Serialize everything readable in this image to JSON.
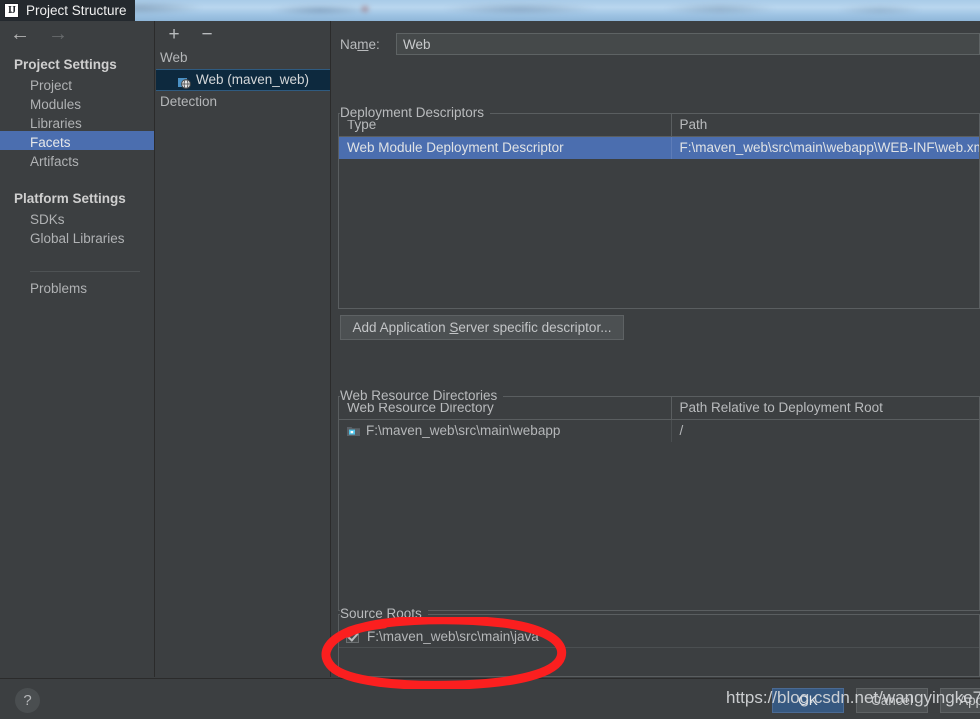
{
  "window": {
    "title": "Project Structure",
    "app_icon": "intellij-idea-icon",
    "icon_text": "IJ"
  },
  "nav": {
    "back_icon": "arrow-left-icon",
    "forward_icon": "arrow-right-icon",
    "groups": [
      {
        "header": "Project Settings",
        "items": [
          {
            "label": "Project",
            "selected": false
          },
          {
            "label": "Modules",
            "selected": false
          },
          {
            "label": "Libraries",
            "selected": false
          },
          {
            "label": "Facets",
            "selected": true
          },
          {
            "label": "Artifacts",
            "selected": false
          }
        ]
      },
      {
        "header": "Platform Settings",
        "items": [
          {
            "label": "SDKs",
            "selected": false
          },
          {
            "label": "Global Libraries",
            "selected": false
          }
        ]
      }
    ],
    "problems": "Problems"
  },
  "facets": {
    "toolbar": {
      "add_label": "+",
      "remove_label": "−"
    },
    "tree": [
      {
        "label": "Web",
        "type": "group",
        "selected": false
      },
      {
        "label": "Web (maven_web)",
        "type": "facet",
        "selected": true
      },
      {
        "label": "Detection",
        "type": "group",
        "selected": false
      }
    ]
  },
  "detail": {
    "name_label_pre": "Na",
    "name_label_mnemonic": "m",
    "name_label_post": "e:",
    "name_value": "Web",
    "name_placeholder": "",
    "deployment_descriptors": {
      "title": "Deployment Descriptors",
      "columns": [
        "Type",
        "Path"
      ],
      "rows": [
        {
          "type": "Web Module Deployment Descriptor",
          "path": "F:\\maven_web\\src\\main\\webapp\\WEB-INF\\web.xml",
          "selected": true
        }
      ]
    },
    "add_descriptor_button": {
      "pre": "Add Application ",
      "mnemonic": "S",
      "post": "erver specific descriptor..."
    },
    "web_resource_directories": {
      "title": "Web Resource Directories",
      "columns": [
        "Web Resource Directory",
        "Path Relative to Deployment Root"
      ],
      "rows": [
        {
          "directory": "F:\\maven_web\\src\\main\\webapp",
          "relative_path": "/",
          "icon": "folder-icon",
          "selected": false
        }
      ]
    },
    "source_roots": {
      "title": "Source Roots",
      "rows": [
        {
          "path": "F:\\maven_web\\src\\main\\java",
          "checked": true
        }
      ]
    }
  },
  "footer": {
    "help_label": "?",
    "help_icon": "question-mark-icon",
    "ok_label": "OK",
    "cancel_label": "Cancel",
    "apply_label": "Apply"
  },
  "overlay": {
    "watermark": "https://blog.csdn.net/wangyingke7",
    "annotation_color": "#fb1f1f",
    "annotation_shape": "hand-drawn-ellipse"
  },
  "colors": {
    "window_bg": "#3c3f41",
    "selection_blue": "#4b6eaf",
    "tree_selection": "#0d293e",
    "primary_button": "#365880",
    "titlebar_bg": "#24292e"
  }
}
